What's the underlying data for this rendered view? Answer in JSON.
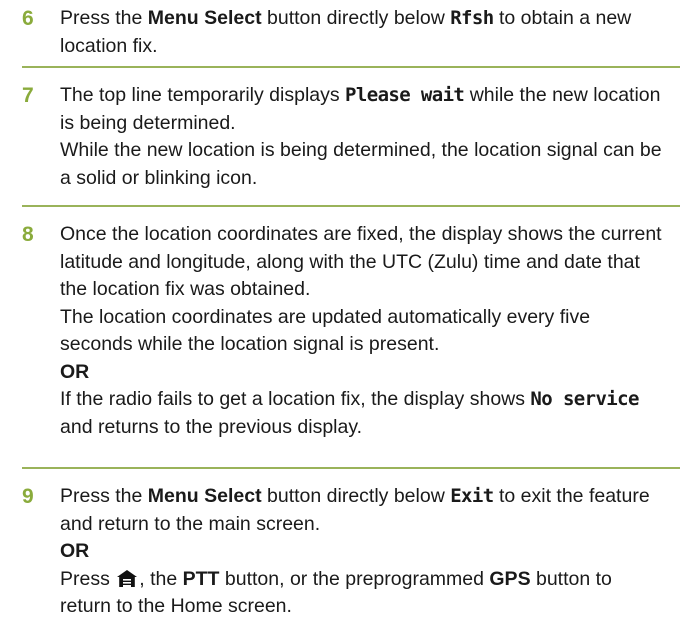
{
  "steps": [
    {
      "number": "6",
      "paragraphs": [
        [
          {
            "t": "Press the "
          },
          {
            "t": "Menu Select",
            "s": "b"
          },
          {
            "t": " button directly below "
          },
          {
            "t": "Rfsh",
            "s": "ui"
          },
          {
            "t": " to obtain a new location fix."
          }
        ]
      ]
    },
    {
      "number": "7",
      "paragraphs": [
        [
          {
            "t": "The top line temporarily displays "
          },
          {
            "t": "Please wait",
            "s": "ui"
          },
          {
            "t": " while the new location is being determined."
          }
        ],
        [
          {
            "t": "While the new location is being determined, the location signal can be a solid or blinking icon."
          }
        ]
      ]
    },
    {
      "number": "8",
      "paragraphs": [
        [
          {
            "t": "Once the location coordinates are fixed, the display shows the current latitude and longitude, along with the UTC (Zulu) time and date that the location fix was obtained."
          }
        ],
        [
          {
            "t": "The location coordinates are updated automatically every five seconds while the location signal is present."
          }
        ],
        [
          {
            "t": "OR",
            "s": "b"
          }
        ],
        [
          {
            "t": "If the radio fails to get a location fix, the display shows "
          },
          {
            "t": "No service",
            "s": "ui"
          },
          {
            "t": " and returns to the previous display."
          }
        ]
      ]
    },
    {
      "number": "9",
      "paragraphs": [
        [
          {
            "t": "Press the "
          },
          {
            "t": "Menu Select",
            "s": "b"
          },
          {
            "t": " button directly below "
          },
          {
            "t": "Exit",
            "s": "ui"
          },
          {
            "t": " to exit the feature and return to the main screen."
          }
        ],
        [
          {
            "t": "OR",
            "s": "b"
          }
        ],
        [
          {
            "t": "Press "
          },
          {
            "icon": "home-icon"
          },
          {
            "t": ", the "
          },
          {
            "t": "PTT",
            "s": "b"
          },
          {
            "t": " button, or the preprogrammed "
          },
          {
            "t": "GPS",
            "s": "b"
          },
          {
            "t": " button to return to the Home screen."
          }
        ]
      ]
    }
  ],
  "colors": {
    "step_number": "#8aab3c",
    "divider": "#9ab35a",
    "text": "#1a1a1a"
  }
}
